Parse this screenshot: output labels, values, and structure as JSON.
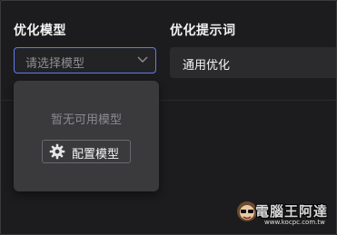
{
  "labels": {
    "model": "优化模型",
    "prompt": "优化提示词"
  },
  "model_select": {
    "placeholder": "请选择模型",
    "chevron_icon": "chevron-down-icon"
  },
  "prompt_select": {
    "value": "通用优化"
  },
  "dropdown": {
    "empty_text": "暂无可用模型",
    "config_button": {
      "label": "配置模型",
      "icon": "gear-icon"
    }
  },
  "watermark": {
    "brand": "電腦王阿達",
    "url": "www.kocpc.com.tw"
  },
  "colors": {
    "background": "#1c1c1e",
    "accent_border": "#5b7cf0",
    "dropdown_bg": "#3a3a3d",
    "input_bg": "#2b2b2e"
  }
}
